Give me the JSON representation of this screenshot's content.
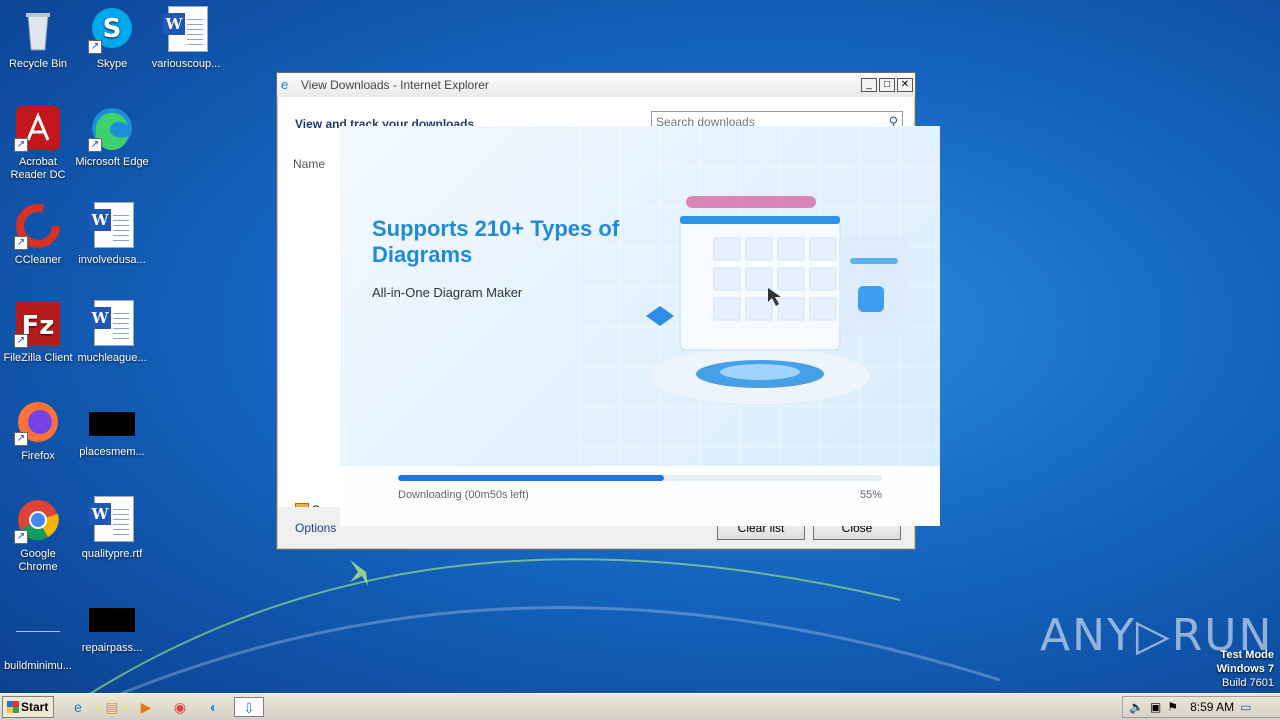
{
  "desktop": {
    "icons": [
      {
        "label": "Recycle Bin"
      },
      {
        "label": "Skype"
      },
      {
        "label": "variouscoup..."
      },
      {
        "label": "Acrobat Reader DC"
      },
      {
        "label": "Microsoft Edge"
      },
      {
        "label": "CCleaner"
      },
      {
        "label": "involvedusa..."
      },
      {
        "label": "FileZilla Client"
      },
      {
        "label": "muchleague..."
      },
      {
        "label": "Firefox"
      },
      {
        "label": "placesmem..."
      },
      {
        "label": "Google Chrome"
      },
      {
        "label": "qualitypre.rtf"
      },
      {
        "label": "buildminimu..."
      },
      {
        "label": "repairpass..."
      }
    ]
  },
  "ie_window": {
    "title": "View Downloads - Internet Explorer",
    "heading": "View and track your downloads",
    "search_placeholder": "Search downloads",
    "column_name": "Name",
    "smartscreen_label": "Smar",
    "options_link": "Options",
    "clear_list_button": "Clear list",
    "close_button": "Close",
    "controls": {
      "minimize": "_",
      "maximize": "□",
      "close": "✕"
    }
  },
  "installer": {
    "headline": "Supports 210+ Types of Diagrams",
    "subtitle": "All-in-One Diagram Maker",
    "progress_fraction": 0.55,
    "progress_status": "Downloading (00m50s left)",
    "progress_percent": "55%"
  },
  "watermark": {
    "brand": "ANY▷RUN",
    "line1": "Test Mode",
    "line2": "Windows 7",
    "line3": "Build 7601"
  },
  "taskbar": {
    "start_label": "Start",
    "clock": "8:59 AM"
  },
  "colors": {
    "accent": "#1f8bd9",
    "progress": "#1b78e0",
    "desktop": "#1565c0"
  }
}
